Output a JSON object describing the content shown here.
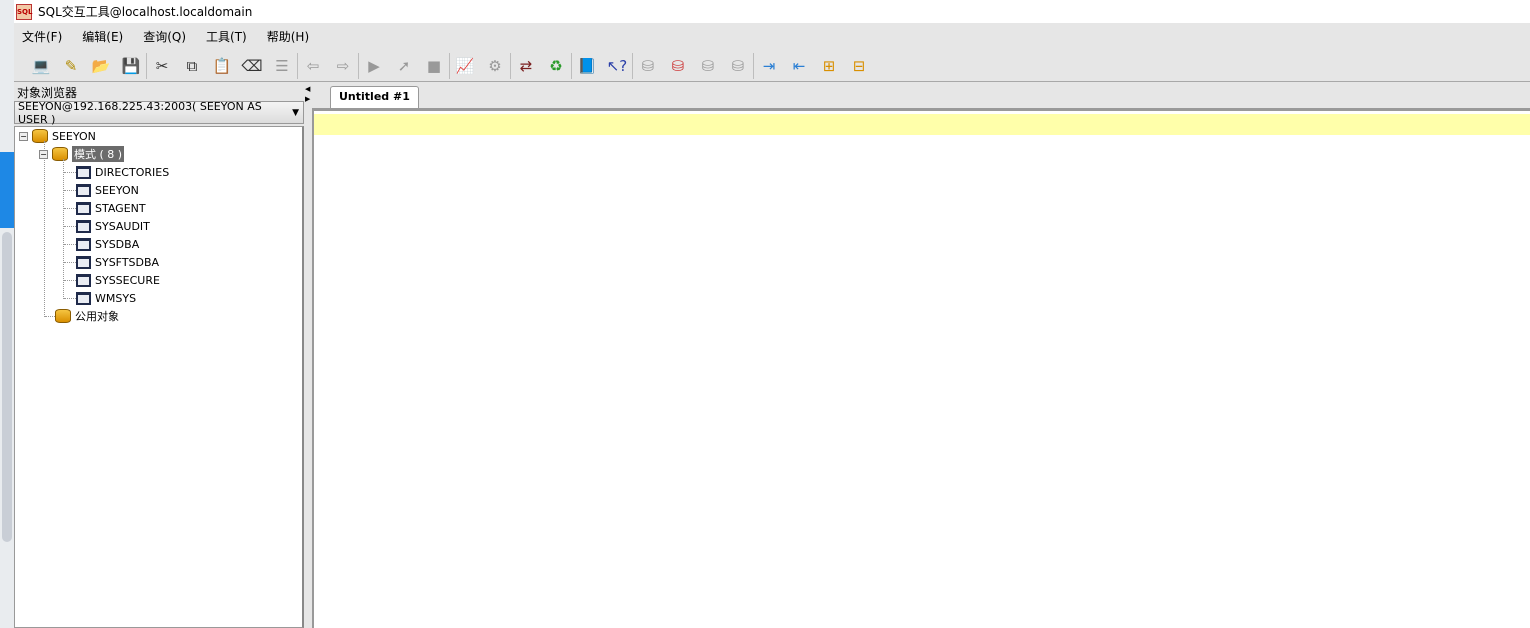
{
  "window": {
    "title": "SQL交互工具@localhost.localdomain",
    "icon": "sql-app-icon",
    "icon_text": "SQL"
  },
  "menu": [
    {
      "label": "文件(F)"
    },
    {
      "label": "编辑(E)"
    },
    {
      "label": "查询(Q)"
    },
    {
      "label": "工具(T)"
    },
    {
      "label": "帮助(H)"
    }
  ],
  "toolbar": [
    [
      {
        "icon": "connect-icon",
        "g": "💻"
      },
      {
        "icon": "edit-icon",
        "g": "✎"
      },
      {
        "icon": "open-folder-icon",
        "g": "📂"
      },
      {
        "icon": "save-icon",
        "g": "💾"
      }
    ],
    [
      {
        "icon": "cut-icon",
        "g": "✂"
      },
      {
        "icon": "copy-icon",
        "g": "⧉"
      },
      {
        "icon": "paste-icon",
        "g": "📋"
      },
      {
        "icon": "clear-icon",
        "g": "⌫"
      },
      {
        "icon": "list-icon",
        "g": "☰"
      }
    ],
    [
      {
        "icon": "back-icon",
        "g": "⇦"
      },
      {
        "icon": "forward-icon",
        "g": "⇨"
      }
    ],
    [
      {
        "icon": "execute-icon",
        "g": "▶"
      },
      {
        "icon": "step-icon",
        "g": "➚"
      },
      {
        "icon": "stop-icon",
        "g": "■"
      }
    ],
    [
      {
        "icon": "explain-plan-icon",
        "g": "📈"
      },
      {
        "icon": "monitor-icon",
        "g": "⚙"
      }
    ],
    [
      {
        "icon": "transfer-icon",
        "g": "⇄"
      },
      {
        "icon": "refresh-icon",
        "g": "♻"
      }
    ],
    [
      {
        "icon": "help-book-icon",
        "g": "📘"
      },
      {
        "icon": "context-help-icon",
        "g": "↖?"
      }
    ],
    [
      {
        "icon": "db-commit-icon",
        "g": "⛁"
      },
      {
        "icon": "db-rollback-icon",
        "g": "⛁"
      },
      {
        "icon": "db-add-icon",
        "g": "⛁"
      },
      {
        "icon": "db-download-icon",
        "g": "⛁"
      }
    ],
    [
      {
        "icon": "indent-icon",
        "g": "⇥"
      },
      {
        "icon": "outdent-icon",
        "g": "⇤"
      },
      {
        "icon": "insert-icon",
        "g": "⊞"
      },
      {
        "icon": "insert-before-icon",
        "g": "⊟"
      }
    ]
  ],
  "browser": {
    "title": "对象浏览器",
    "connection": "SEEYON@192.168.225.43:2003( SEEYON AS USER )",
    "root": "SEEYON",
    "schemas_label": "模式 ( 8 )",
    "schemas": [
      "DIRECTORIES",
      "SEEYON",
      "STAGENT",
      "SYSAUDIT",
      "SYSDBA",
      "SYSFTSDBA",
      "SYSSECURE",
      "WMSYS"
    ],
    "public": "公用对象"
  },
  "editor": {
    "tab": "Untitled #1",
    "current_line_color": "#ffffaa"
  }
}
